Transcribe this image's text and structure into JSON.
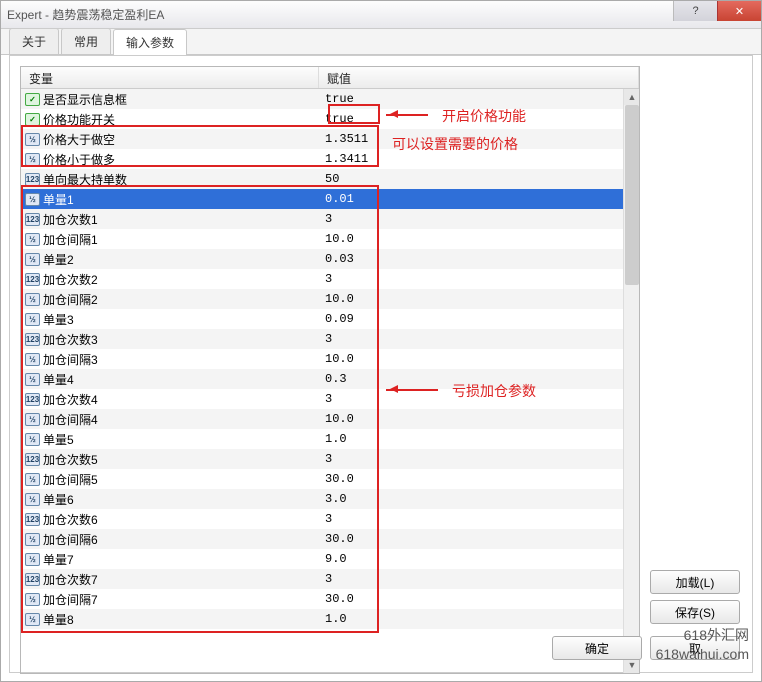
{
  "window": {
    "title": "Expert - 趋势震荡稳定盈利EA"
  },
  "tabs": {
    "about": "关于",
    "common": "常用",
    "inputs": "输入参数"
  },
  "columns": {
    "name": "变量",
    "value": "赋值"
  },
  "rows": [
    {
      "icon": "bool",
      "label": "是否显示信息框",
      "value": "true",
      "selected": false
    },
    {
      "icon": "bool",
      "label": "价格功能开关",
      "value": "true",
      "selected": false
    },
    {
      "icon": "dbl",
      "label": "价格大于做空",
      "value": "1.3511",
      "selected": false
    },
    {
      "icon": "dbl",
      "label": "价格小于做多",
      "value": "1.3411",
      "selected": false
    },
    {
      "icon": "int",
      "label": "单向最大持单数",
      "value": "50",
      "selected": false
    },
    {
      "icon": "dbl",
      "label": "单量1",
      "value": "0.01",
      "selected": true
    },
    {
      "icon": "int",
      "label": "加仓次数1",
      "value": "3",
      "selected": false
    },
    {
      "icon": "dbl",
      "label": "加仓间隔1",
      "value": "10.0",
      "selected": false
    },
    {
      "icon": "dbl",
      "label": "单量2",
      "value": "0.03",
      "selected": false
    },
    {
      "icon": "int",
      "label": "加仓次数2",
      "value": "3",
      "selected": false
    },
    {
      "icon": "dbl",
      "label": "加仓间隔2",
      "value": "10.0",
      "selected": false
    },
    {
      "icon": "dbl",
      "label": "单量3",
      "value": "0.09",
      "selected": false
    },
    {
      "icon": "int",
      "label": "加仓次数3",
      "value": "3",
      "selected": false
    },
    {
      "icon": "dbl",
      "label": "加仓间隔3",
      "value": "10.0",
      "selected": false
    },
    {
      "icon": "dbl",
      "label": "单量4",
      "value": "0.3",
      "selected": false
    },
    {
      "icon": "int",
      "label": "加仓次数4",
      "value": "3",
      "selected": false
    },
    {
      "icon": "dbl",
      "label": "加仓间隔4",
      "value": "10.0",
      "selected": false
    },
    {
      "icon": "dbl",
      "label": "单量5",
      "value": "1.0",
      "selected": false
    },
    {
      "icon": "int",
      "label": "加仓次数5",
      "value": "3",
      "selected": false
    },
    {
      "icon": "dbl",
      "label": "加仓间隔5",
      "value": "30.0",
      "selected": false
    },
    {
      "icon": "dbl",
      "label": "单量6",
      "value": "3.0",
      "selected": false
    },
    {
      "icon": "int",
      "label": "加仓次数6",
      "value": "3",
      "selected": false
    },
    {
      "icon": "dbl",
      "label": "加仓间隔6",
      "value": "30.0",
      "selected": false
    },
    {
      "icon": "dbl",
      "label": "单量7",
      "value": "9.0",
      "selected": false
    },
    {
      "icon": "int",
      "label": "加仓次数7",
      "value": "3",
      "selected": false
    },
    {
      "icon": "dbl",
      "label": "加仓间隔7",
      "value": "30.0",
      "selected": false
    },
    {
      "icon": "dbl",
      "label": "单量8",
      "value": "1.0",
      "selected": false
    }
  ],
  "buttons": {
    "load": "加载(L)",
    "save": "保存(S)",
    "ok": "确定",
    "cancel": "取"
  },
  "annotations": {
    "a1": "开启价格功能",
    "a2": "可以设置需要的价格",
    "a3": "亏损加仓参数"
  },
  "watermark": {
    "l1": "618外汇网",
    "l2": "618waihui.com"
  }
}
